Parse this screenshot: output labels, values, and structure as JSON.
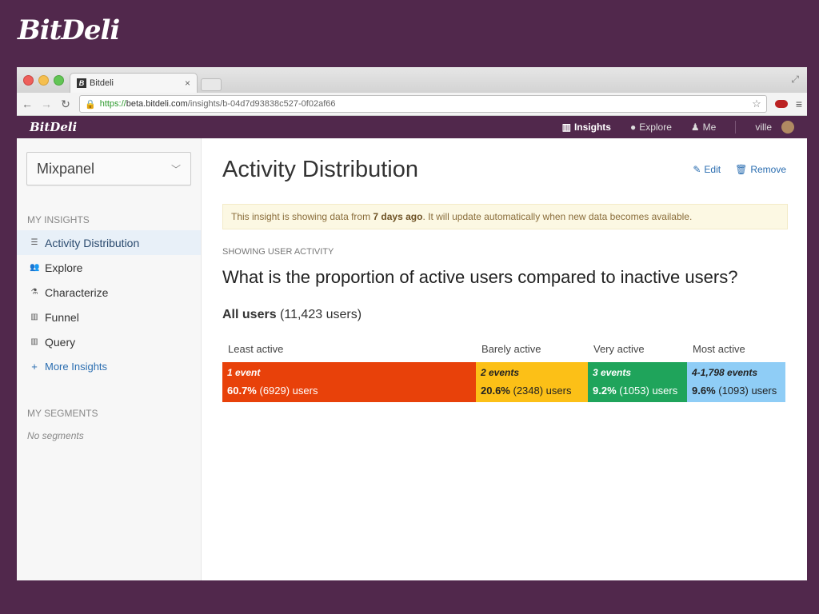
{
  "brand": "BitDeli",
  "browser": {
    "tab_title": "Bitdeli",
    "tab_favicon": "B",
    "tab_close": "×",
    "url_scheme": "https://",
    "url_host": "beta.bitdeli.com",
    "url_path": "/insights/b-04d7d93838c527-0f02af66"
  },
  "appnav": {
    "logo": "BitDeli",
    "links": [
      {
        "label": "Insights",
        "icon": "bar-chart-icon"
      },
      {
        "label": "Explore",
        "icon": "globe-icon"
      },
      {
        "label": "Me",
        "icon": "user-icon"
      }
    ],
    "user": "ville"
  },
  "sidebar": {
    "source_select": "Mixpanel",
    "insights_heading": "MY INSIGHTS",
    "items": [
      {
        "label": "Activity Distribution",
        "icon": "list-icon"
      },
      {
        "label": "Explore",
        "icon": "users-icon"
      },
      {
        "label": "Characterize",
        "icon": "flask-icon"
      },
      {
        "label": "Funnel",
        "icon": "bar-chart-icon"
      },
      {
        "label": "Query",
        "icon": "bar-chart-icon"
      }
    ],
    "more_label": "More Insights",
    "segments_heading": "MY SEGMENTS",
    "segments_empty": "No segments"
  },
  "main": {
    "title": "Activity Distribution",
    "edit_label": "Edit",
    "remove_label": "Remove",
    "notice_prefix": "This insight is showing data from ",
    "notice_bold": "7 days ago",
    "notice_suffix": ". It will update automatically when new data becomes available.",
    "subheading": "SHOWING USER ACTIVITY",
    "question": "What is the proportion of active users compared to inactive users?",
    "all_users_label": "All users",
    "all_users_count": "(11,423 users)"
  },
  "distribution": {
    "segments": [
      {
        "heading": "Least active",
        "events": "1 event",
        "percent": "60.7%",
        "count": "(6929) users",
        "color": "#e8410a",
        "text_color": "#ffffff",
        "share": 0.607
      },
      {
        "heading": "Barely active",
        "events": "2 events",
        "percent": "20.6%",
        "count": "(2348) users",
        "color": "#fcc017",
        "text_color": "#222222",
        "share": 0.206
      },
      {
        "heading": "Very active",
        "events": "3 events",
        "percent": "9.2%",
        "count": "(1053) users",
        "color": "#1fa45b",
        "text_color": "#ffffff",
        "share": 0.092
      },
      {
        "heading": "Most active",
        "events": "4-1,798 events",
        "percent": "9.6%",
        "count": "(1093) users",
        "color": "#8fcdf6",
        "text_color": "#222222",
        "share": 0.096
      }
    ]
  }
}
